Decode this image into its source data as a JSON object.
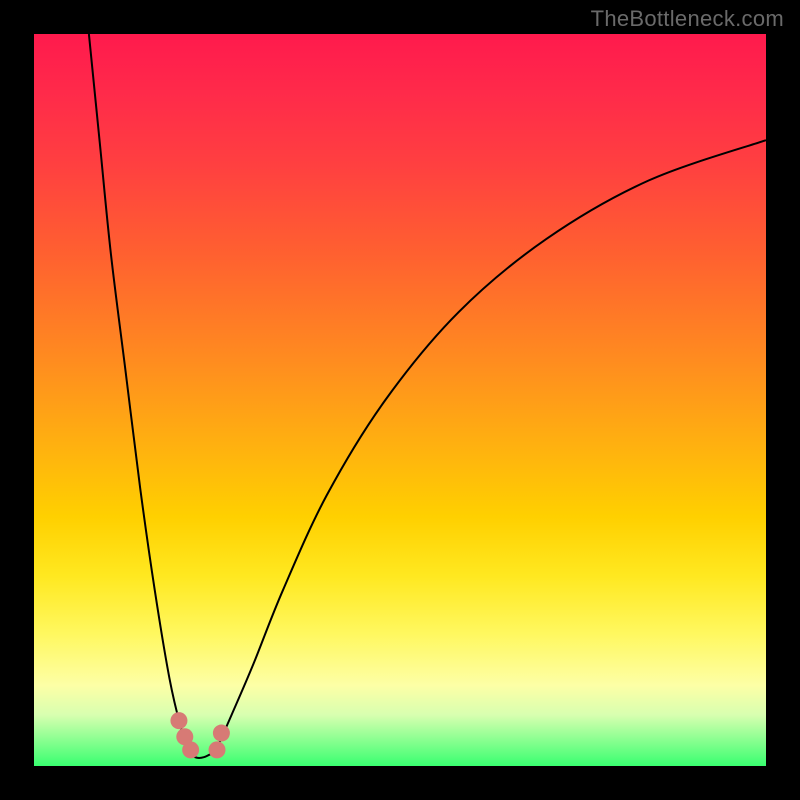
{
  "watermark": "TheBottleneck.com",
  "colors": {
    "background": "#000000",
    "curve_stroke": "#000000",
    "marker_fill": "#d77a75",
    "marker_stroke": "#b05a55"
  },
  "chart_data": {
    "type": "line",
    "title": "",
    "xlabel": "",
    "ylabel": "",
    "xlim": [
      0,
      1
    ],
    "ylim": [
      0,
      1
    ],
    "grid": false,
    "legend": false,
    "description": "Two smooth black curves on a red-to-green vertical gradient. Both curves fall from the top toward a minimum near the bottom around x≈0.22, then the right branch rises again toward the upper-right. A few salmon-colored marker dots sit near the trough. Axis values are implied (0–1 normalized).",
    "series": [
      {
        "name": "left_branch",
        "x": [
          0.075,
          0.09,
          0.105,
          0.125,
          0.145,
          0.165,
          0.185,
          0.2,
          0.212
        ],
        "y": [
          1.0,
          0.85,
          0.7,
          0.54,
          0.38,
          0.24,
          0.12,
          0.055,
          0.02
        ]
      },
      {
        "name": "floor",
        "x": [
          0.212,
          0.22,
          0.232,
          0.248
        ],
        "y": [
          0.02,
          0.012,
          0.012,
          0.02
        ]
      },
      {
        "name": "right_branch",
        "x": [
          0.248,
          0.27,
          0.3,
          0.34,
          0.4,
          0.48,
          0.58,
          0.7,
          0.84,
          1.0
        ],
        "y": [
          0.02,
          0.07,
          0.14,
          0.24,
          0.37,
          0.5,
          0.62,
          0.72,
          0.8,
          0.855
        ]
      }
    ],
    "markers": [
      {
        "x": 0.198,
        "y": 0.062
      },
      {
        "x": 0.206,
        "y": 0.04
      },
      {
        "x": 0.214,
        "y": 0.022
      },
      {
        "x": 0.25,
        "y": 0.022
      },
      {
        "x": 0.256,
        "y": 0.045
      }
    ]
  }
}
